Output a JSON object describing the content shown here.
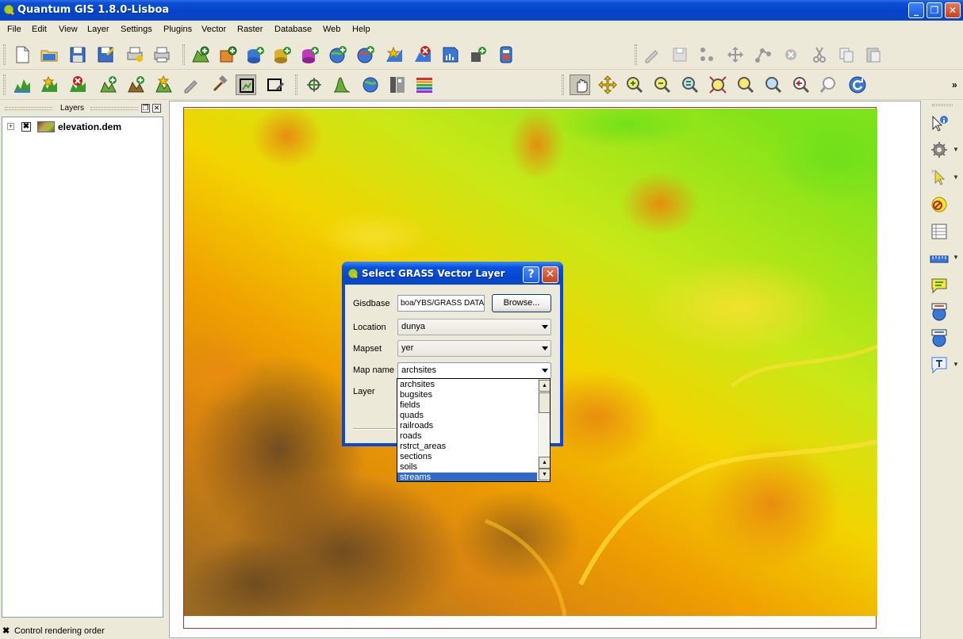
{
  "window": {
    "title": "Quantum GIS 1.8.0-Lisboa",
    "minimize": "_",
    "maximize": "❐",
    "close": "✕"
  },
  "menu": [
    "File",
    "Edit",
    "View",
    "Layer",
    "Settings",
    "Plugins",
    "Vector",
    "Raster",
    "Database",
    "Web",
    "Help"
  ],
  "toolbar_overflow": "»",
  "layers_panel": {
    "title": "Layers",
    "float_btn": "❐",
    "close_btn": "✕",
    "layers": [
      {
        "name": "elevation.dem",
        "checked": "✖",
        "expander": "+"
      }
    ]
  },
  "status": {
    "checkbox": "✖",
    "label": "Control rendering order"
  },
  "dialog": {
    "title": "Select GRASS Vector Layer",
    "help_btn": "?",
    "close_btn": "✕",
    "gisdbase_label": "Gisdbase",
    "gisdbase_value": "boa/YBS/GRASS DATA",
    "browse_btn": "Browse...",
    "location_label": "Location",
    "location_value": "dunya",
    "mapset_label": "Mapset",
    "mapset_value": "yer",
    "mapname_label": "Map name",
    "mapname_value": "archsites",
    "layer_label": "Layer"
  },
  "dropdown": {
    "items": [
      "archsites",
      "bugsites",
      "fields",
      "quads",
      "railroads",
      "roads",
      "rstrct_areas",
      "sections",
      "soils",
      "streams"
    ],
    "selected": "streams",
    "scroll_up": "▲",
    "scroll_down": "▼"
  }
}
